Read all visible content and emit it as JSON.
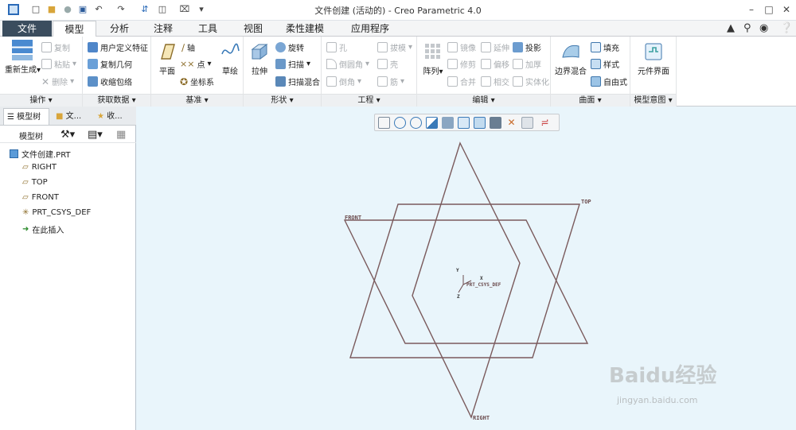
{
  "window": {
    "title": "文件创建 (活动的) - Creo Parametric 4.0"
  },
  "tabs": [
    {
      "label": "文件"
    },
    {
      "label": "模型"
    },
    {
      "label": "分析"
    },
    {
      "label": "注释"
    },
    {
      "label": "工具"
    },
    {
      "label": "视图"
    },
    {
      "label": "柔性建模"
    },
    {
      "label": "应用程序"
    }
  ],
  "ribbon": {
    "operations": {
      "label": "操作",
      "regenerate": "重新生成",
      "copy": "复制",
      "paste": "粘贴",
      "delete": "删除"
    },
    "get_data": {
      "label": "获取数据",
      "udf": "用户定义特征",
      "copy_geometry": "复制几何",
      "shrinkwrap": "收缩包络"
    },
    "datum": {
      "label": "基准",
      "plane": "平面",
      "axis": "轴",
      "point": "点",
      "csys": "坐标系",
      "sketch": "草绘"
    },
    "shapes": {
      "label": "形状",
      "extrude": "拉伸",
      "revolve": "旋转",
      "sweep": "扫描",
      "swept_blend": "扫描混合"
    },
    "engineering": {
      "label": "工程",
      "hole": "孔",
      "round": "倒圆角",
      "chamfer": "倒角",
      "draft": "拔模",
      "shell": "壳",
      "rib": "筋"
    },
    "editing": {
      "label": "编辑",
      "pattern": "阵列",
      "mirror": "镜像",
      "trim": "修剪",
      "merge": "合并",
      "extend": "延伸",
      "offset": "偏移",
      "intersect": "相交",
      "project": "投影",
      "thicken": "加厚",
      "solidify": "实体化"
    },
    "surfaces": {
      "label": "曲面",
      "boundary_blend": "边界混合",
      "fill": "填充",
      "style": "样式",
      "freestyle": "自由式"
    },
    "model_intent": {
      "label": "模型意图",
      "component_interface": "元件界面"
    }
  },
  "left_panel": {
    "tabs": [
      {
        "label": "模型树"
      },
      {
        "label": "文..."
      },
      {
        "label": "收..."
      }
    ],
    "toolbar_label": "模型树",
    "tree": [
      {
        "label": "文件创建.PRT",
        "icon": "part-icon"
      },
      {
        "label": "RIGHT",
        "icon": "datum-plane-icon"
      },
      {
        "label": "TOP",
        "icon": "datum-plane-icon"
      },
      {
        "label": "FRONT",
        "icon": "datum-plane-icon"
      },
      {
        "label": "PRT_CSYS_DEF",
        "icon": "csys-icon"
      },
      {
        "label": "在此插入",
        "icon": "insert-arrow-icon"
      }
    ]
  },
  "graphics": {
    "plane_labels": {
      "front": "FRONT",
      "top": "TOP",
      "right": "RIGHT"
    },
    "csys": {
      "label": "PRT_CSYS_DEF",
      "x": "X",
      "y": "Y",
      "z": "Z"
    },
    "datum_color": "#7a5a5c"
  },
  "watermark": {
    "text": "Baidu经验",
    "url": "jingyan.baidu.com"
  }
}
